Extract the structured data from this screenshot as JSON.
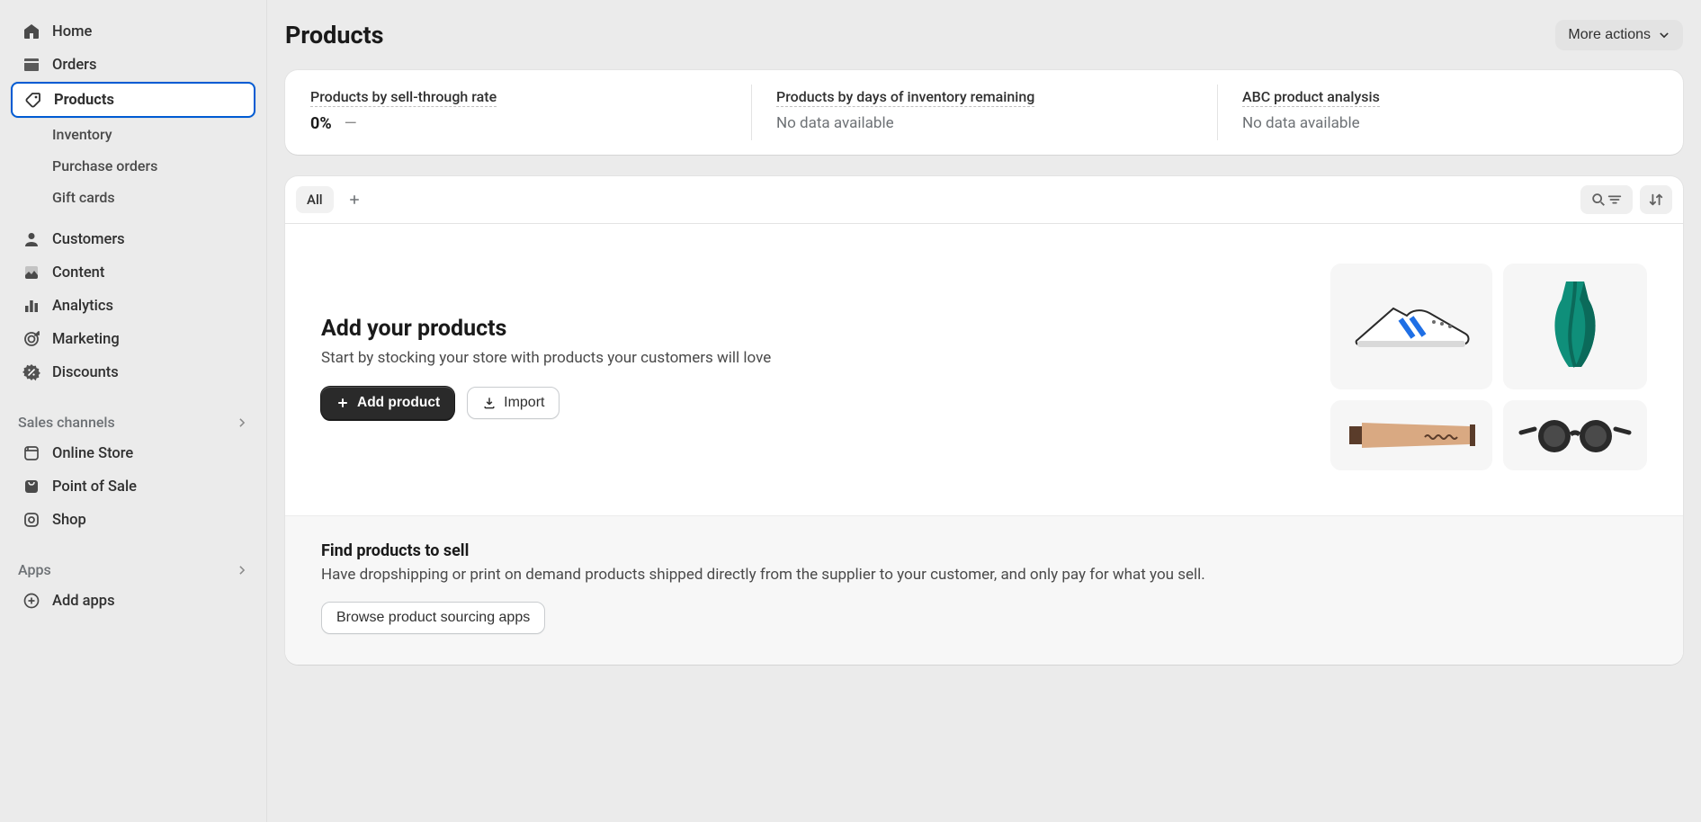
{
  "sidebar": {
    "items": [
      {
        "label": "Home"
      },
      {
        "label": "Orders"
      },
      {
        "label": "Products",
        "active": true
      },
      {
        "label": "Customers"
      },
      {
        "label": "Content"
      },
      {
        "label": "Analytics"
      },
      {
        "label": "Marketing"
      },
      {
        "label": "Discounts"
      }
    ],
    "products_sub": [
      {
        "label": "Inventory"
      },
      {
        "label": "Purchase orders"
      },
      {
        "label": "Gift cards"
      }
    ],
    "sales_channels_header": "Sales channels",
    "sales_channels": [
      {
        "label": "Online Store"
      },
      {
        "label": "Point of Sale"
      },
      {
        "label": "Shop"
      }
    ],
    "apps_header": "Apps",
    "add_apps_label": "Add apps"
  },
  "page": {
    "title": "Products",
    "more_actions": "More actions"
  },
  "stats": [
    {
      "label": "Products by sell-through rate",
      "value": "0%",
      "dash": true
    },
    {
      "label": "Products by days of inventory remaining",
      "nodata": "No data available"
    },
    {
      "label": "ABC product analysis",
      "nodata": "No data available"
    }
  ],
  "tabs": {
    "all": "All"
  },
  "empty_state": {
    "heading": "Add your products",
    "subheading": "Start by stocking your store with products your customers will love",
    "add_button": "Add product",
    "import_button": "Import"
  },
  "find_section": {
    "heading": "Find products to sell",
    "body": "Have dropshipping or print on demand products shipped directly from the supplier to your customer, and only pay for what you sell.",
    "browse_button": "Browse product sourcing apps"
  }
}
